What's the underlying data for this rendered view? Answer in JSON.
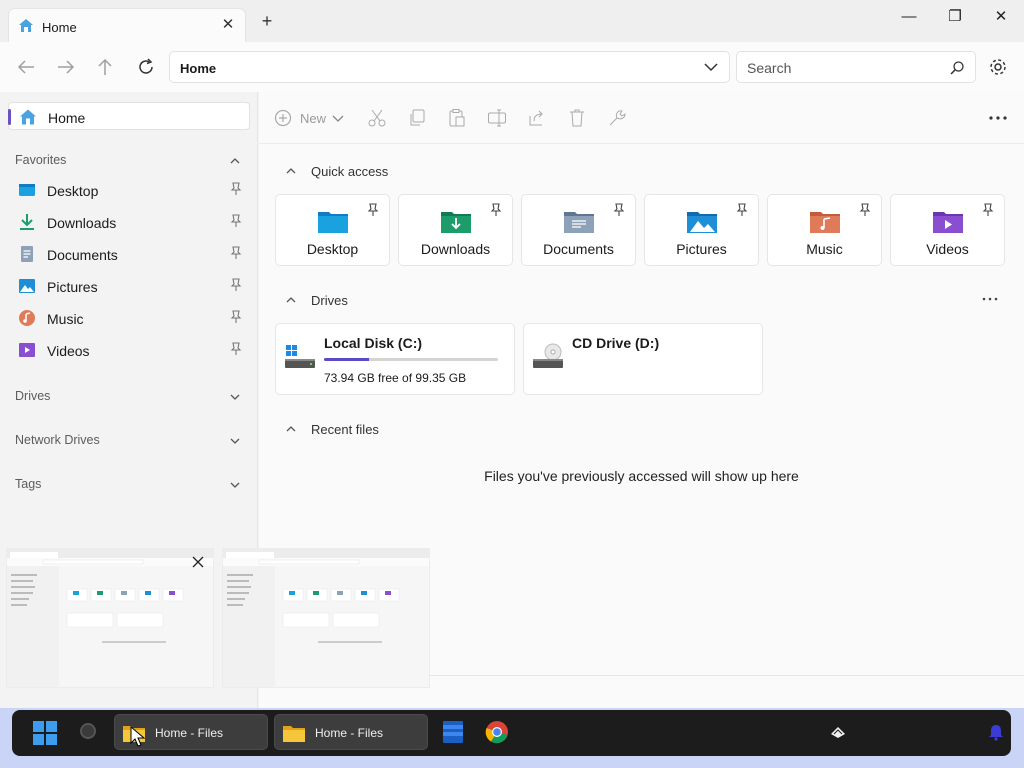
{
  "window": {
    "tab_title": "Home",
    "tab_close": "✕",
    "new_tab": "+",
    "minimize": "—",
    "maximize": "❐",
    "close": "✕"
  },
  "nav": {
    "address": "Home",
    "search_placeholder": "Search"
  },
  "sidebar": {
    "home_label": "Home",
    "favorites_header": "Favorites",
    "favorites": [
      {
        "label": "Desktop",
        "icon": "desktop-icon"
      },
      {
        "label": "Downloads",
        "icon": "downloads-icon"
      },
      {
        "label": "Documents",
        "icon": "documents-icon"
      },
      {
        "label": "Pictures",
        "icon": "pictures-icon"
      },
      {
        "label": "Music",
        "icon": "music-icon"
      },
      {
        "label": "Videos",
        "icon": "videos-icon"
      }
    ],
    "drives_header": "Drives",
    "network_header": "Network Drives",
    "tags_header": "Tags"
  },
  "toolbar": {
    "new_label": "New"
  },
  "main": {
    "quick_access_header": "Quick access",
    "quick_access": [
      {
        "label": "Desktop",
        "color": "#1aa1e0"
      },
      {
        "label": "Downloads",
        "color": "#1c9c6b"
      },
      {
        "label": "Documents",
        "color": "#7d94ad"
      },
      {
        "label": "Pictures",
        "color": "#1e8fd6"
      },
      {
        "label": "Music",
        "color": "#e07b5a"
      },
      {
        "label": "Videos",
        "color": "#8a4fd1"
      }
    ],
    "drives_header": "Drives",
    "drives": [
      {
        "name": "Local Disk (C:)",
        "free": "73.94 GB free of 99.35 GB",
        "used_fraction": 0.256
      },
      {
        "name": "CD Drive (D:)"
      }
    ],
    "recent_header": "Recent files",
    "recent_empty": "Files you've previously accessed will show up here"
  },
  "taskbar": {
    "windows": [
      {
        "label": "Home - Files"
      },
      {
        "label": "Home - Files"
      }
    ]
  },
  "colors": {
    "accent": "#5b4bc4",
    "taskbar": "#1c1c1c",
    "desktop_bg": "#c9d4f7"
  }
}
